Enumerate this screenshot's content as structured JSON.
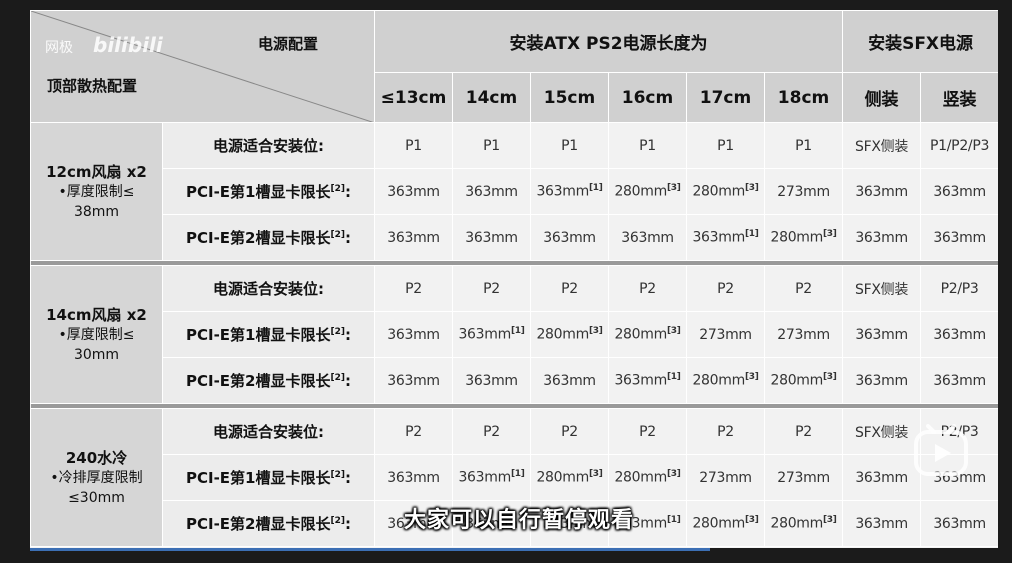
{
  "watermark": {
    "site": "网极",
    "logo": "bilibili"
  },
  "header": {
    "corner_top": "电源配置",
    "corner_bottom": "顶部散热配置",
    "atx_group": "安装ATX PS2电源长度为",
    "sfx_group": "安装SFX电源",
    "columns": [
      "≤13cm",
      "14cm",
      "15cm",
      "16cm",
      "17cm",
      "18cm",
      "侧装",
      "竖装"
    ]
  },
  "groups": [
    {
      "title": "12cm风扇 x2",
      "line2": "•厚度限制≤",
      "line3": "38mm",
      "rows": [
        {
          "label": "电源适合安装位:",
          "sup": "",
          "cells": [
            [
              "P1",
              ""
            ],
            [
              "P1",
              ""
            ],
            [
              "P1",
              ""
            ],
            [
              "P1",
              ""
            ],
            [
              "P1",
              ""
            ],
            [
              "P1",
              ""
            ],
            [
              "SFX侧装",
              ""
            ],
            [
              "P1/P2/P3",
              ""
            ]
          ]
        },
        {
          "label": "PCI-E第1槽显卡限长",
          "sup": "[2]",
          "cells": [
            [
              "363mm",
              ""
            ],
            [
              "363mm",
              ""
            ],
            [
              "363mm",
              "[1]"
            ],
            [
              "280mm",
              "[3]"
            ],
            [
              "280mm",
              "[3]"
            ],
            [
              "273mm",
              ""
            ],
            [
              "363mm",
              ""
            ],
            [
              "363mm",
              ""
            ]
          ]
        },
        {
          "label": "PCI-E第2槽显卡限长",
          "sup": "[2]",
          "cells": [
            [
              "363mm",
              ""
            ],
            [
              "363mm",
              ""
            ],
            [
              "363mm",
              ""
            ],
            [
              "363mm",
              ""
            ],
            [
              "363mm",
              "[1]"
            ],
            [
              "280mm",
              "[3]"
            ],
            [
              "363mm",
              ""
            ],
            [
              "363mm",
              ""
            ]
          ]
        }
      ]
    },
    {
      "title": "14cm风扇 x2",
      "line2": "•厚度限制≤",
      "line3": "30mm",
      "rows": [
        {
          "label": "电源适合安装位:",
          "sup": "",
          "cells": [
            [
              "P2",
              ""
            ],
            [
              "P2",
              ""
            ],
            [
              "P2",
              ""
            ],
            [
              "P2",
              ""
            ],
            [
              "P2",
              ""
            ],
            [
              "P2",
              ""
            ],
            [
              "SFX侧装",
              ""
            ],
            [
              "P2/P3",
              ""
            ]
          ]
        },
        {
          "label": "PCI-E第1槽显卡限长",
          "sup": "[2]",
          "cells": [
            [
              "363mm",
              ""
            ],
            [
              "363mm",
              "[1]"
            ],
            [
              "280mm",
              "[3]"
            ],
            [
              "280mm",
              "[3]"
            ],
            [
              "273mm",
              ""
            ],
            [
              "273mm",
              ""
            ],
            [
              "363mm",
              ""
            ],
            [
              "363mm",
              ""
            ]
          ]
        },
        {
          "label": "PCI-E第2槽显卡限长",
          "sup": "[2]",
          "cells": [
            [
              "363mm",
              ""
            ],
            [
              "363mm",
              ""
            ],
            [
              "363mm",
              ""
            ],
            [
              "363mm",
              "[1]"
            ],
            [
              "280mm",
              "[3]"
            ],
            [
              "280mm",
              "[3]"
            ],
            [
              "363mm",
              ""
            ],
            [
              "363mm",
              ""
            ]
          ]
        }
      ]
    },
    {
      "title": "240水冷",
      "line2": "•冷排厚度限制",
      "line3": "≤30mm",
      "rows": [
        {
          "label": "电源适合安装位:",
          "sup": "",
          "cells": [
            [
              "P2",
              ""
            ],
            [
              "P2",
              ""
            ],
            [
              "P2",
              ""
            ],
            [
              "P2",
              ""
            ],
            [
              "P2",
              ""
            ],
            [
              "P2",
              ""
            ],
            [
              "SFX侧装",
              ""
            ],
            [
              "P2/P3",
              ""
            ]
          ]
        },
        {
          "label": "PCI-E第1槽显卡限长",
          "sup": "[2]",
          "cells": [
            [
              "363mm",
              ""
            ],
            [
              "363mm",
              "[1]"
            ],
            [
              "280mm",
              "[3]"
            ],
            [
              "280mm",
              "[3]"
            ],
            [
              "273mm",
              ""
            ],
            [
              "273mm",
              ""
            ],
            [
              "363mm",
              ""
            ],
            [
              "363mm",
              ""
            ]
          ]
        },
        {
          "label": "PCI-E第2槽显卡限长",
          "sup": "[2]",
          "cells": [
            [
              "363mm",
              ""
            ],
            [
              "363mm",
              ""
            ],
            [
              "363mm",
              ""
            ],
            [
              "363mm",
              "[1]"
            ],
            [
              "280mm",
              "[3]"
            ],
            [
              "280mm",
              "[3]"
            ],
            [
              "363mm",
              ""
            ],
            [
              "363mm",
              ""
            ]
          ]
        }
      ]
    }
  ],
  "subtitle": "大家可以自行暂停观看",
  "colors": {
    "header_bg": "#d0d0d0",
    "cell_bg": "#f2f2f2",
    "progress": "#3c6fb4"
  }
}
